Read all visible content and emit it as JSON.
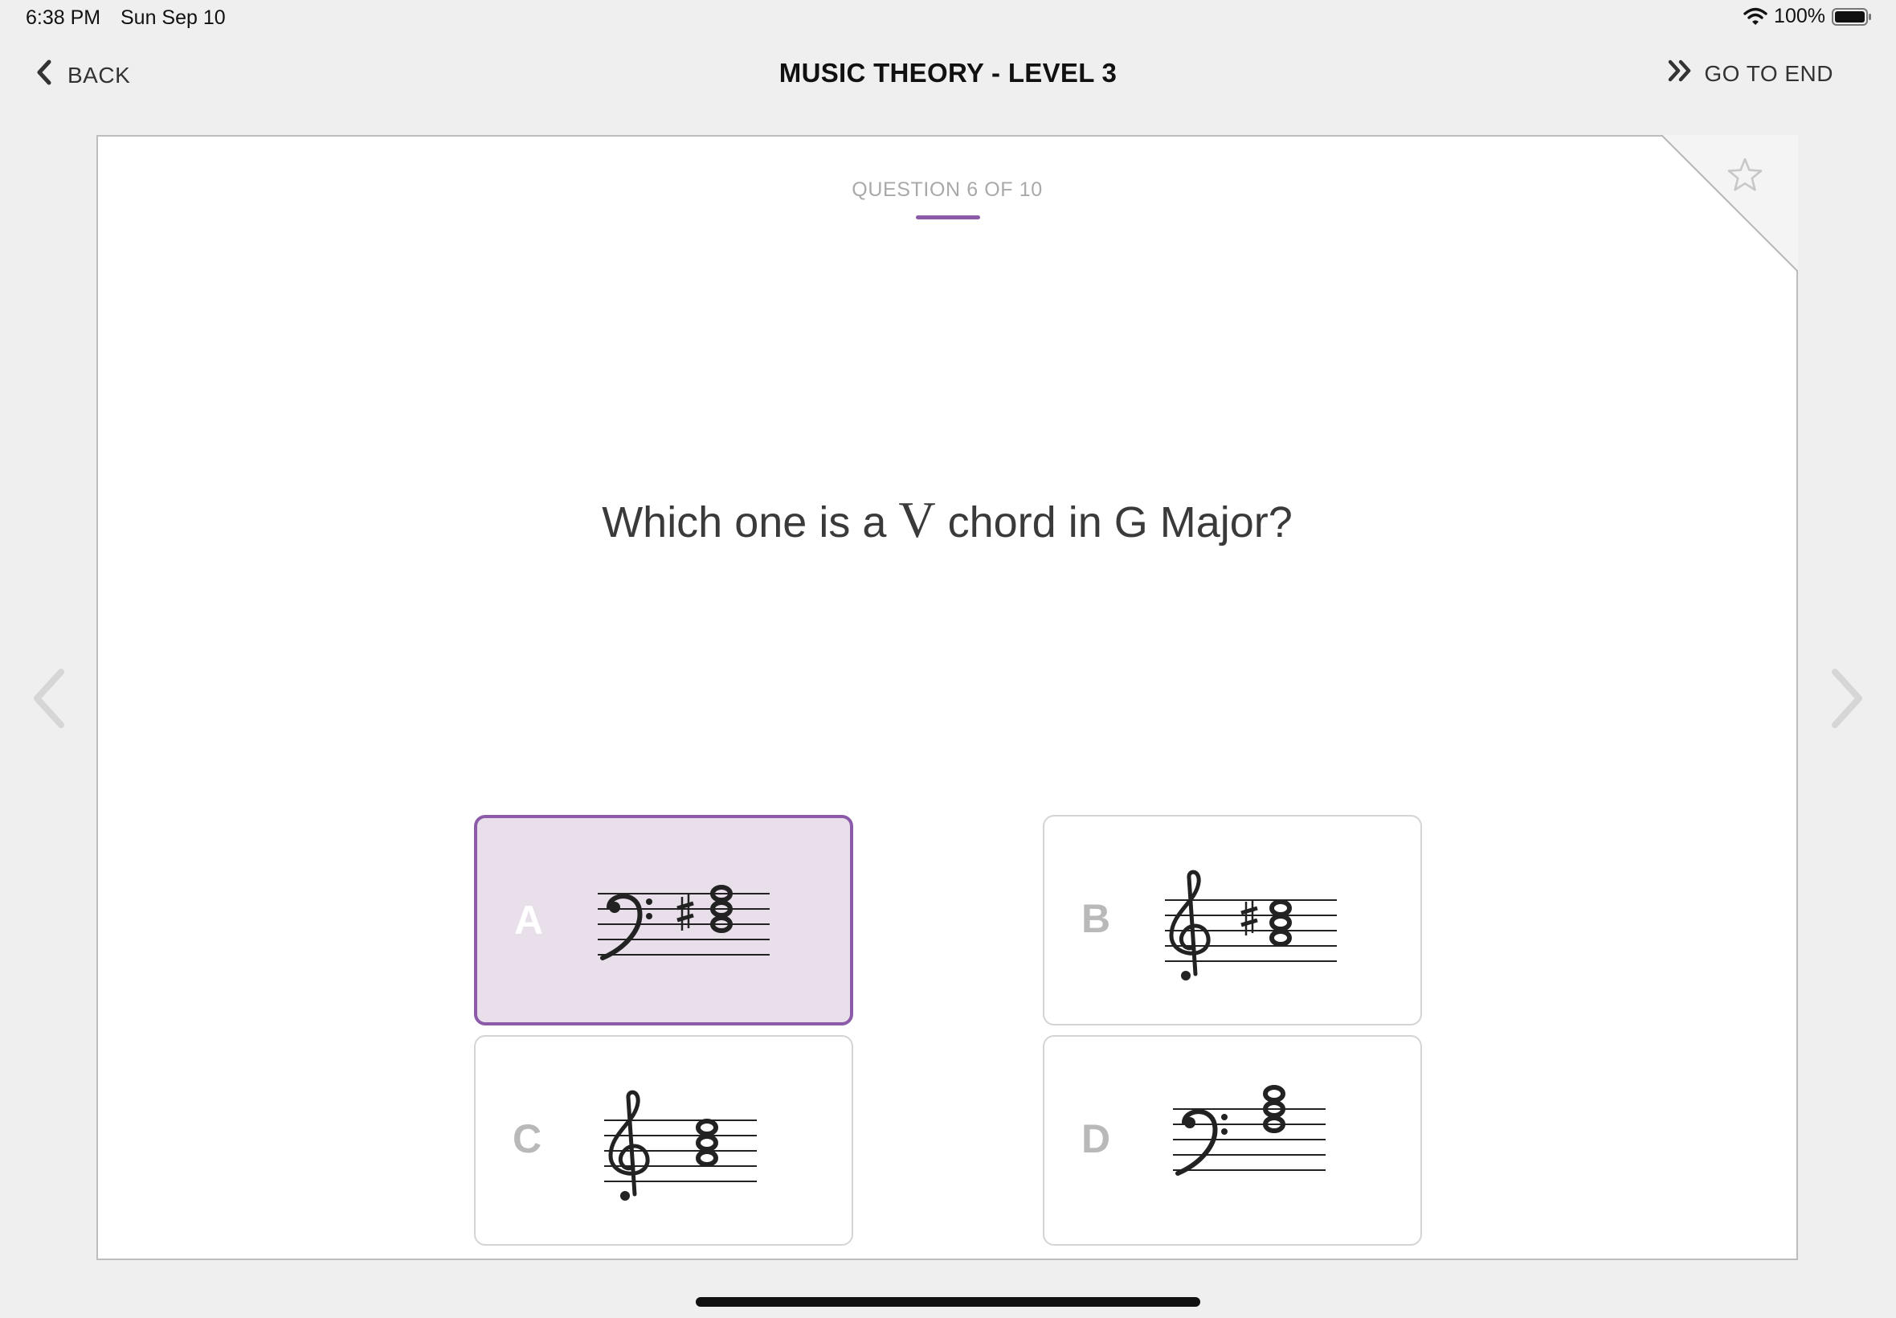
{
  "status_bar": {
    "time": "6:38 PM",
    "date": "Sun Sep 10",
    "battery": "100%"
  },
  "header": {
    "back_label": "BACK",
    "title": "MUSIC THEORY - LEVEL 3",
    "go_to_end_label": "GO TO END"
  },
  "question": {
    "counter": "QUESTION 6 OF 10",
    "text_before": "Which one is a",
    "numeral": "V",
    "text_after": "chord in G Major?"
  },
  "options": [
    {
      "letter": "A",
      "clef": "bass",
      "accidental": "sharp",
      "selected": true
    },
    {
      "letter": "B",
      "clef": "treble",
      "accidental": "sharp",
      "selected": false
    },
    {
      "letter": "C",
      "clef": "treble",
      "accidental": "none",
      "selected": false
    },
    {
      "letter": "D",
      "clef": "bass",
      "accidental": "none",
      "selected": false
    }
  ],
  "colors": {
    "accent": "#8b5aa8",
    "selected_bg": "#e8dfeb",
    "page_bg": "#efefef"
  }
}
